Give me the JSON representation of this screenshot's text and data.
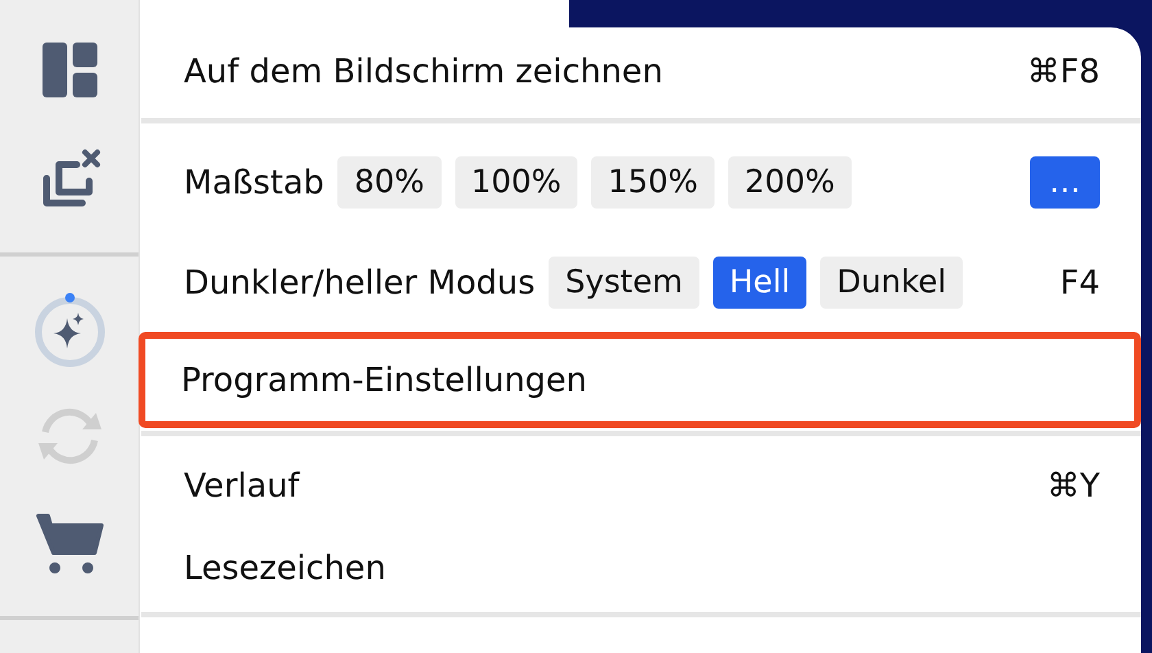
{
  "sidebar": {
    "items": [
      {
        "kind": "dashboard",
        "disabled": false
      },
      {
        "kind": "close-copy",
        "disabled": false
      },
      {
        "kind": "divider"
      },
      {
        "kind": "ai",
        "disabled": false
      },
      {
        "kind": "sync",
        "disabled": true
      },
      {
        "kind": "cart",
        "disabled": false
      },
      {
        "kind": "divider"
      }
    ]
  },
  "menu": {
    "items": [
      {
        "kind": "action",
        "label": "Auf dem Bildschirm zeichnen",
        "shortcut": "⌘F8",
        "highlighted": false
      },
      {
        "kind": "separator"
      },
      {
        "kind": "zoom",
        "label": "Maßstab",
        "options": [
          {
            "label": "80%",
            "selected": false
          },
          {
            "label": "100%",
            "selected": false
          },
          {
            "label": "150%",
            "selected": false
          },
          {
            "label": "200%",
            "selected": false
          }
        ],
        "more": "…"
      },
      {
        "kind": "mode",
        "label": "Dunkler/heller Modus",
        "options": [
          {
            "label": "System",
            "selected": false
          },
          {
            "label": "Hell",
            "selected": true
          },
          {
            "label": "Dunkel",
            "selected": false
          }
        ],
        "shortcut": "F4"
      },
      {
        "kind": "action",
        "label": "Programm-Einstellungen",
        "highlighted": true
      },
      {
        "kind": "separator"
      },
      {
        "kind": "action",
        "label": "Verlauf",
        "shortcut": "⌘Y",
        "highlighted": false
      },
      {
        "kind": "action",
        "label": "Lesezeichen",
        "highlighted": false
      },
      {
        "kind": "separator"
      }
    ]
  }
}
